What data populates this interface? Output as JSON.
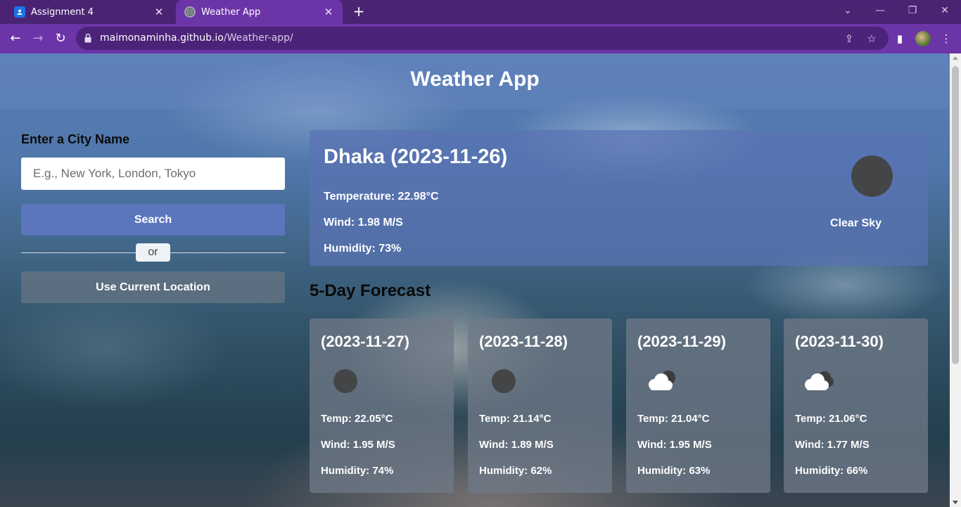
{
  "browser": {
    "tabs": [
      {
        "title": "Assignment 4",
        "active": false,
        "icon": "classroom-icon"
      },
      {
        "title": "Weather App",
        "active": true,
        "icon": "globe-icon"
      }
    ],
    "url_host": "maimonaminha.github.io",
    "url_path": "/Weather-app/"
  },
  "app": {
    "title": "Weather App"
  },
  "search_panel": {
    "label": "Enter a City Name",
    "placeholder": "E.g., New York, London, Tokyo",
    "value": "",
    "search_label": "Search",
    "or_label": "or",
    "location_label": "Use Current Location"
  },
  "current": {
    "heading": "Dhaka (2023-11-26)",
    "temperature": "Temperature: 22.98°C",
    "wind": "Wind: 1.98 M/S",
    "humidity": "Humidity: 73%",
    "description": "Clear Sky",
    "icon": "clear-sky-icon"
  },
  "forecast": {
    "title": "5-Day Forecast",
    "days": [
      {
        "date": "(2023-11-27)",
        "temp": "Temp: 22.05°C",
        "wind": "Wind: 1.95 M/S",
        "humidity": "Humidity: 74%",
        "icon": "clear-sky-icon"
      },
      {
        "date": "(2023-11-28)",
        "temp": "Temp: 21.14°C",
        "wind": "Wind: 1.89 M/S",
        "humidity": "Humidity: 62%",
        "icon": "clear-sky-icon"
      },
      {
        "date": "(2023-11-29)",
        "temp": "Temp: 21.04°C",
        "wind": "Wind: 1.95 M/S",
        "humidity": "Humidity: 63%",
        "icon": "cloudy-icon"
      },
      {
        "date": "(2023-11-30)",
        "temp": "Temp: 21.06°C",
        "wind": "Wind: 1.77 M/S",
        "humidity": "Humidity: 66%",
        "icon": "cloudy-icon"
      }
    ]
  },
  "colors": {
    "chrome_tabstrip": "#4a2473",
    "chrome_toolbar": "#6b35a8",
    "search_button": "#5f78c3",
    "current_card": "#5a73b4"
  }
}
